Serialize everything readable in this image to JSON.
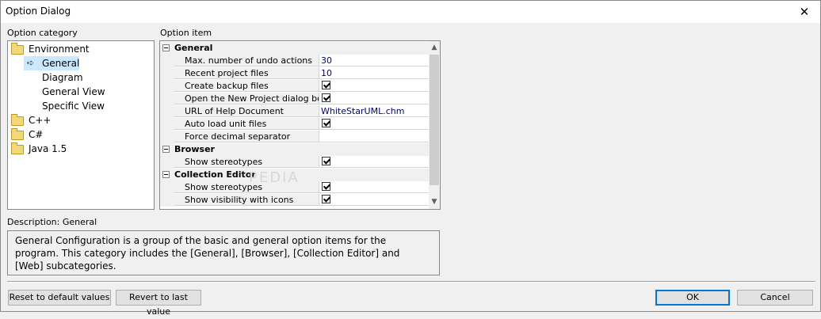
{
  "window": {
    "title": "Option Dialog",
    "close_glyph": "✕"
  },
  "category": {
    "label": "Option category",
    "items": [
      {
        "label": "Environment",
        "icon": "folder-icon"
      },
      {
        "label": "General",
        "icon": "arrow-icon",
        "selected": true
      },
      {
        "label": "Diagram"
      },
      {
        "label": "General View"
      },
      {
        "label": "Specific View"
      },
      {
        "label": "C++",
        "icon": "folder-icon"
      },
      {
        "label": "C#",
        "icon": "folder-icon"
      },
      {
        "label": "Java 1.5",
        "icon": "folder-icon"
      }
    ]
  },
  "options": {
    "label": "Option item",
    "sections": [
      {
        "name": "General"
      },
      {
        "name": "Browser"
      },
      {
        "name": "Collection Editor"
      }
    ],
    "rows": [
      {
        "name": "Max. number of undo actions",
        "value": "30"
      },
      {
        "name": "Recent project files",
        "value": "10"
      },
      {
        "name": "Create backup files",
        "checked": true
      },
      {
        "name": "Open the New Project dialog box a",
        "checked": true
      },
      {
        "name": "URL of Help Document",
        "value": "WhiteStarUML.chm"
      },
      {
        "name": "Auto load unit files",
        "checked": true
      },
      {
        "name": "Force decimal separator",
        "value": ""
      },
      {
        "name": "Show stereotypes",
        "checked": true
      },
      {
        "name": "Show stereotypes",
        "checked": true
      },
      {
        "name": "Show visibility with icons",
        "checked": true
      }
    ],
    "watermark": "PEDIA"
  },
  "description": {
    "label": "Description: General",
    "text": "General Configuration is a group of the basic and general option items for the program. This category includes the [General], [Browser], [Collection Editor] and [Web] subcategories."
  },
  "buttons": {
    "reset": "Reset to default values",
    "revert": "Revert to last value",
    "ok": "OK",
    "cancel": "Cancel"
  },
  "scrollbar": {
    "up": "▲",
    "down": "▼"
  }
}
